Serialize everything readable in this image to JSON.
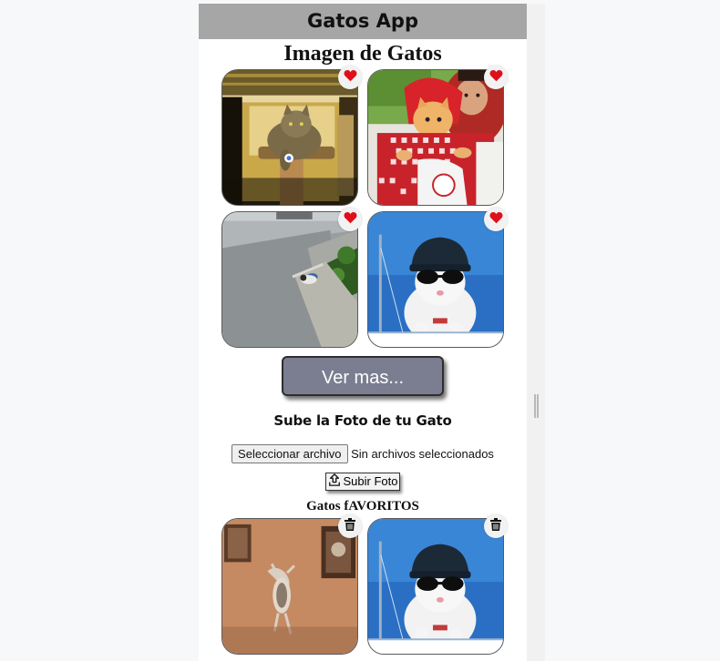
{
  "header": {
    "title": "Gatos App"
  },
  "gallery": {
    "title": "Imagen de Gatos",
    "images": [
      {
        "subject": "cat-on-wooden-post",
        "action_icon": "heart-icon"
      },
      {
        "subject": "cat-in-red-hood-costume",
        "action_icon": "heart-icon"
      },
      {
        "subject": "cat-on-street",
        "action_icon": "heart-icon"
      },
      {
        "subject": "cat-with-helmet-and-sunglasses",
        "action_icon": "heart-icon"
      }
    ],
    "more_button": "Ver mas..."
  },
  "upload": {
    "title": "Sube la Foto de tu Gato",
    "file_button": "Seleccionar archivo",
    "file_status": "Sin archivos seleccionados",
    "submit_button": "Subir Foto"
  },
  "favorites": {
    "title": "Gatos fAVORITOS",
    "images": [
      {
        "subject": "cat-jumping-at-wall",
        "action_icon": "trash-icon"
      },
      {
        "subject": "cat-with-helmet-and-sunglasses",
        "action_icon": "trash-icon"
      }
    ]
  },
  "colors": {
    "header_bg": "#a6a6a6",
    "more_button_bg": "#7b7e91",
    "heart": "#e0101b"
  }
}
